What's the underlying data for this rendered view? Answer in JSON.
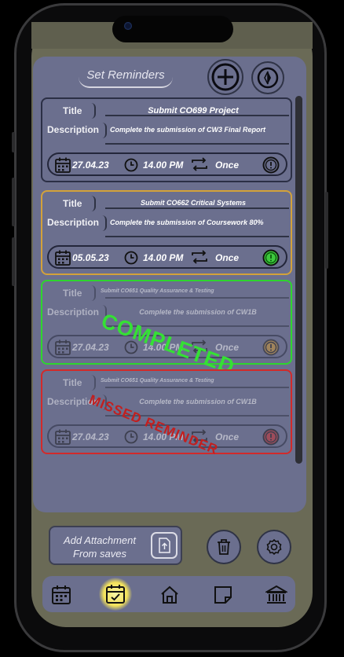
{
  "header": {
    "set_reminders": "Set Reminders"
  },
  "labels": {
    "title": "Title",
    "description": "Description"
  },
  "reminders": [
    {
      "title": "Submit CO699 Project",
      "description": "Complete the submission of CW3 Final Report",
      "date": "27.04.23",
      "time": "14.00 PM",
      "repeat": "Once",
      "state": "pending",
      "border_color": "#2b2f45"
    },
    {
      "title": "Submit CO662 Critical Systems",
      "description": "Complete the submission of Coursework 80%",
      "date": "05.05.23",
      "time": "14.00 PM",
      "repeat": "Once",
      "state": "active",
      "border_color": "#d3a23a"
    },
    {
      "title": "Submit CO651 Quality Assurance & Testing",
      "description": "Complete the submission of CW1B",
      "date": "27.04.23",
      "time": "14.00 PM",
      "repeat": "Once",
      "state": "completed",
      "border_color": "#2ed52e",
      "stamp": "COMPLETED"
    },
    {
      "title": "Submit CO651 Quality Assurance & Testing",
      "description": "Complete the submission of CW1B",
      "date": "27.04.23",
      "time": "14.00 PM",
      "repeat": "Once",
      "state": "missed",
      "border_color": "#d22a2a",
      "stamp": "MISSED REMINDER"
    }
  ],
  "attachment": {
    "line1": "Add Attachment",
    "line2": "From saves"
  },
  "nav": {
    "items": [
      "calendar-icon",
      "calendar-check-icon",
      "home-icon",
      "note-icon",
      "bank-icon"
    ],
    "active": "calendar-check-icon"
  },
  "colors": {
    "panel": "#6b6f8e",
    "background": "#6a6a56",
    "active_glow": "#f3e25a"
  }
}
